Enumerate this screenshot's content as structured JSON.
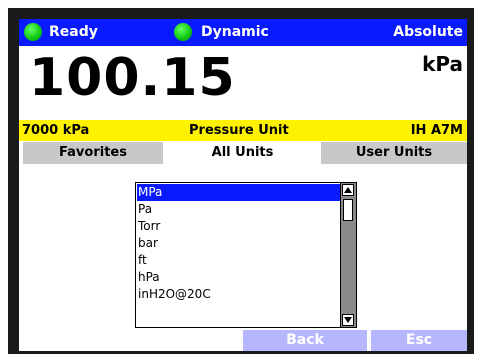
{
  "status_bar": {
    "ready_label": "Ready",
    "mode_label": "Dynamic",
    "reference_label": "Absolute",
    "indicator_color": "#12cc12",
    "bar_color": "#0a1aff"
  },
  "measurement": {
    "value": "100.15",
    "unit": "kPa"
  },
  "info_bar": {
    "range": "7000 kPa",
    "title": "Pressure Unit",
    "model": "IH A7M",
    "bar_color": "#fff200"
  },
  "tabs": [
    {
      "label": "Favorites",
      "active": false
    },
    {
      "label": "All Units",
      "active": true
    },
    {
      "label": "User Units",
      "active": false
    }
  ],
  "unit_list": {
    "items": [
      "MPa",
      "Pa",
      "Torr",
      "bar",
      "ft",
      "hPa",
      "inH2O@20C"
    ],
    "selected": "MPa"
  },
  "buttons": {
    "back_label": "Back",
    "esc_label": "Esc"
  }
}
